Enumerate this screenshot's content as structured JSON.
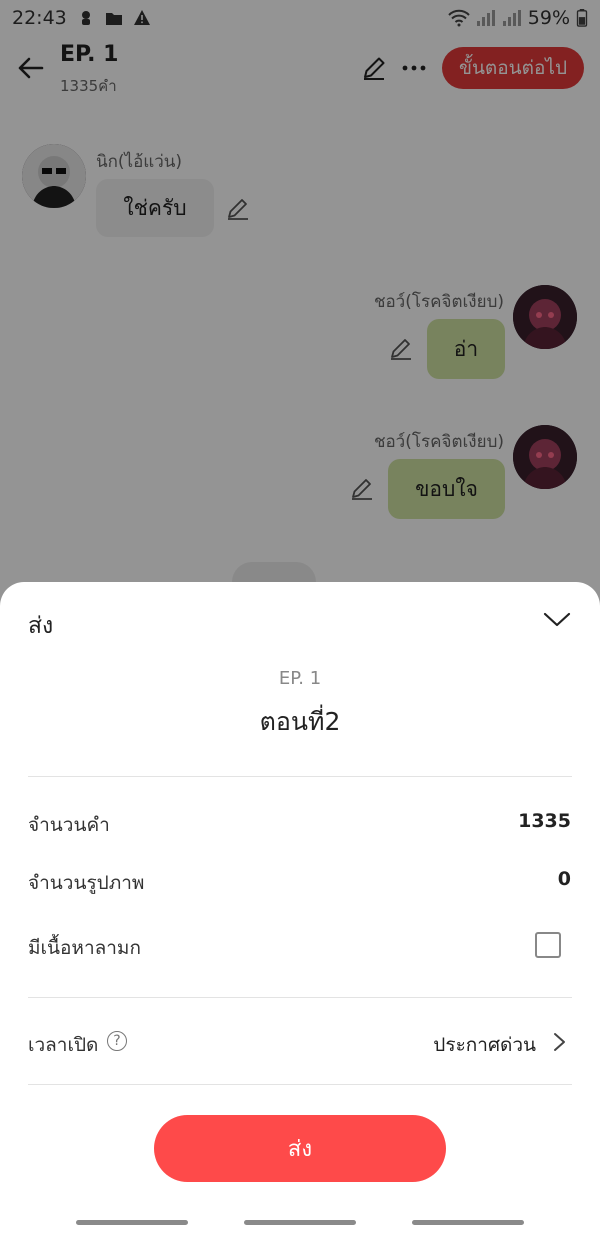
{
  "status_bar": {
    "time": "22:43",
    "battery": "59%"
  },
  "header": {
    "episode_title": "EP. 1",
    "word_count": "1335คำ",
    "next_button_label": "ขั้นตอนต่อไป"
  },
  "chat": {
    "messages": [
      {
        "side": "left",
        "sender": "นิก(ไอ้แว่น)",
        "text": "ใช่ครับ"
      },
      {
        "side": "right",
        "sender": "ชอว์(โรคจิตเงียบ)",
        "text": "อ่า"
      },
      {
        "side": "right",
        "sender": "ชอว์(โรคจิตเงียบ)",
        "text": "ขอบใจ"
      }
    ]
  },
  "sheet": {
    "title": "ส่ง",
    "episode_label": "EP. 1",
    "chapter_name": "ตอนที่2",
    "rows": {
      "word_count_label": "จำนวนคำ",
      "word_count_value": "1335",
      "image_count_label": "จำนวนรูปภาพ",
      "image_count_value": "0",
      "mature_label": "มีเนื้อหาลามก",
      "mature_checked": false,
      "open_time_label": "เวลาเปิด",
      "help_symbol": "?",
      "open_time_value": "ประกาศด่วน"
    },
    "send_button_label": "ส่ง"
  },
  "icons": {
    "back": "arrow-left-icon",
    "edit": "pencil-icon",
    "more": "more-horizontal-icon",
    "collapse": "chevron-down-icon",
    "open_time_chevron": "chevron-right-icon"
  },
  "colors": {
    "accent_red": "#fe4a4a",
    "header_button_red": "#e23a3a",
    "right_bubble": "#cfe2a2",
    "left_bubble": "#f1f1f1"
  }
}
